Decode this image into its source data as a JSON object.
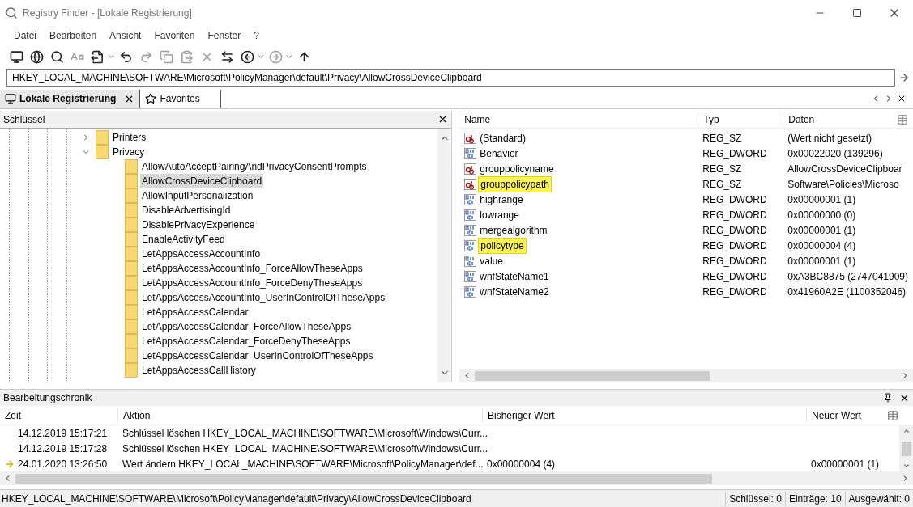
{
  "window": {
    "title": "Registry Finder - [Lokale Registrierung]"
  },
  "menu": [
    "Datei",
    "Bearbeiten",
    "Ansicht",
    "Favoriten",
    "Fenster",
    "?"
  ],
  "address": {
    "value": "HKEY_LOCAL_MACHINE\\SOFTWARE\\Microsoft\\PolicyManager\\default\\Privacy\\AllowCrossDeviceClipboard"
  },
  "tabs": [
    {
      "label": "Lokale Registrierung",
      "selected": true
    },
    {
      "label": "Favorites",
      "selected": false
    }
  ],
  "tree": {
    "title": "Schlüssel",
    "items": [
      {
        "label": "Printers",
        "expanded": false,
        "selected": false
      },
      {
        "label": "Privacy",
        "expanded": true,
        "selected": false,
        "children": [
          {
            "label": "AllowAutoAcceptPairingAndPrivacyConsentPrompts",
            "selected": false
          },
          {
            "label": "AllowCrossDeviceClipboard",
            "selected": true
          },
          {
            "label": "AllowInputPersonalization",
            "selected": false
          },
          {
            "label": "DisableAdvertisingId",
            "selected": false
          },
          {
            "label": "DisablePrivacyExperience",
            "selected": false
          },
          {
            "label": "EnableActivityFeed",
            "selected": false
          },
          {
            "label": "LetAppsAccessAccountInfo",
            "selected": false
          },
          {
            "label": "LetAppsAccessAccountInfo_ForceAllowTheseApps",
            "selected": false
          },
          {
            "label": "LetAppsAccessAccountInfo_ForceDenyTheseApps",
            "selected": false
          },
          {
            "label": "LetAppsAccessAccountInfo_UserInControlOfTheseApps",
            "selected": false
          },
          {
            "label": "LetAppsAccessCalendar",
            "selected": false
          },
          {
            "label": "LetAppsAccessCalendar_ForceAllowTheseApps",
            "selected": false
          },
          {
            "label": "LetAppsAccessCalendar_ForceDenyTheseApps",
            "selected": false
          },
          {
            "label": "LetAppsAccessCalendar_UserInControlOfTheseApps",
            "selected": false
          },
          {
            "label": "LetAppsAccessCallHistory",
            "selected": false
          }
        ]
      }
    ]
  },
  "values": {
    "columns": [
      "Name",
      "Typ",
      "Daten"
    ],
    "rows": [
      {
        "kind": "string",
        "name": "(Standard)",
        "type": "REG_SZ",
        "data": "(Wert nicht gesetzt)",
        "highlighted": false
      },
      {
        "kind": "dword",
        "name": "Behavior",
        "type": "REG_DWORD",
        "data": "0x00022020 (139296)",
        "highlighted": false
      },
      {
        "kind": "string",
        "name": "grouppolicyname",
        "type": "REG_SZ",
        "data": "AllowCrossDeviceClipboar",
        "highlighted": false
      },
      {
        "kind": "string",
        "name": "grouppolicypath",
        "type": "REG_SZ",
        "data": "Software\\Policies\\Microso",
        "highlighted": true
      },
      {
        "kind": "dword",
        "name": "highrange",
        "type": "REG_DWORD",
        "data": "0x00000001 (1)",
        "highlighted": false
      },
      {
        "kind": "dword",
        "name": "lowrange",
        "type": "REG_DWORD",
        "data": "0x00000000 (0)",
        "highlighted": false
      },
      {
        "kind": "dword",
        "name": "mergealgorithm",
        "type": "REG_DWORD",
        "data": "0x00000001 (1)",
        "highlighted": false
      },
      {
        "kind": "dword",
        "name": "policytype",
        "type": "REG_DWORD",
        "data": "0x00000004 (4)",
        "highlighted": true
      },
      {
        "kind": "dword",
        "name": "value",
        "type": "REG_DWORD",
        "data": "0x00000001 (1)",
        "highlighted": false
      },
      {
        "kind": "dword",
        "name": "wnfStateName1",
        "type": "REG_DWORD",
        "data": "0xA3BC8875 (2747041909)",
        "highlighted": false
      },
      {
        "kind": "dword",
        "name": "wnfStateName2",
        "type": "REG_DWORD",
        "data": "0x41960A2E (1100352046)",
        "highlighted": false
      }
    ]
  },
  "history": {
    "title": "Bearbeitungschronik",
    "columns": [
      "Zeit",
      "Aktion",
      "Bisheriger Wert",
      "Neuer Wert"
    ],
    "rows": [
      {
        "time": "14.12.2019 15:17:21",
        "action": "Schlüssel löschen HKEY_LOCAL_MACHINE\\SOFTWARE\\Microsoft\\Windows\\Curr...",
        "old": "",
        "new": "",
        "current": false
      },
      {
        "time": "14.12.2019 15:17:28",
        "action": "Schlüssel löschen HKEY_LOCAL_MACHINE\\SOFTWARE\\Microsoft\\Windows\\Curr...",
        "old": "",
        "new": "",
        "current": false
      },
      {
        "time": "24.01.2020 13:26:50",
        "action": "Wert ändern HKEY_LOCAL_MACHINE\\SOFTWARE\\Microsoft\\PolicyManager\\def...",
        "old": "0x00000004 (4)",
        "new": "0x00000001 (1)",
        "current": true
      }
    ]
  },
  "status_bar": {
    "path": "HKEY_LOCAL_MACHINE\\SOFTWARE\\Microsoft\\PolicyManager\\default\\Privacy\\AllowCrossDeviceClipboard",
    "keys": "Schlüssel: 0",
    "entries": "Einträge: 10",
    "selected": "Ausgewählt: 0"
  }
}
